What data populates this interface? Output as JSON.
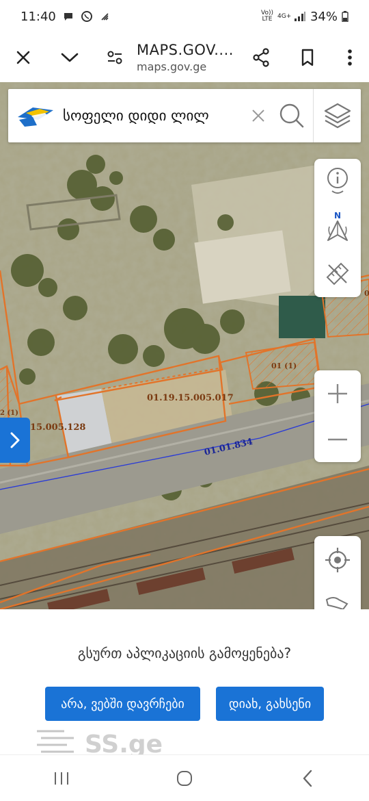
{
  "status_bar": {
    "time": "11:40",
    "network_label": "Vo)) LTE",
    "network_type": "4G+",
    "battery": "34%"
  },
  "browser_bar": {
    "page_title": "MAPS.GOV....",
    "url": "maps.gov.ge"
  },
  "search": {
    "query": "სოფელი დიდი ლილ"
  },
  "map": {
    "parcel_labels": [
      "01.19.15.005.017",
      "15.005.128",
      "01 (1)",
      "2 (1)",
      "0"
    ],
    "road_label": "01.01.834",
    "colors": {
      "parcel_outline": "#e2742a",
      "road_line": "#2a3bd6"
    }
  },
  "controls": {
    "info_icon": "info-pin-icon",
    "compass_icon": "compass-north-icon",
    "compass_letter": "N",
    "measure_icon": "ruler-pencil-icon",
    "zoom_in_icon": "plus-icon",
    "zoom_out_icon": "minus-icon",
    "locate_icon": "crosshair-icon"
  },
  "sheet": {
    "question": "გსურთ აპლიკაციის გამოყენება?",
    "no_button": "არა, ვებში დავრჩები",
    "yes_button": "დიახ, გახსენი",
    "accent_color": "#1a73d6"
  },
  "watermark": {
    "text": "SS.ge"
  }
}
